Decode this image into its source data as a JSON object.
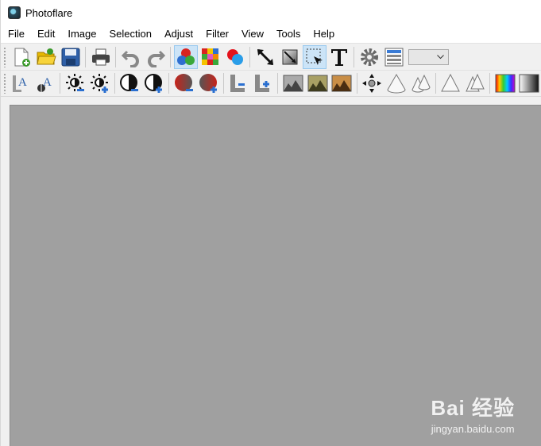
{
  "window": {
    "title": "Photoflare"
  },
  "menu": [
    "File",
    "Edit",
    "Image",
    "Selection",
    "Adjust",
    "Filter",
    "View",
    "Tools",
    "Help"
  ],
  "toolbar1": [
    "new-file-icon",
    "open-folder-icon",
    "save-icon",
    "print-icon",
    "undo-icon",
    "redo-icon",
    "color-circles-icon",
    "color-palette-icon",
    "color-picker-icon",
    "line-arrow-icon",
    "crop-icon",
    "select-arrow-icon",
    "text-tool-icon",
    "settings-gear-icon",
    "layers-icon"
  ],
  "toolbar2": [
    "font-a-icon",
    "font-a-fill-icon",
    "brightness-down-icon",
    "brightness-up-icon",
    "contrast-down-icon",
    "contrast-up-icon",
    "saturation-down-icon",
    "saturation-up-icon",
    "level-l-down-icon",
    "level-l-up-icon",
    "landscape-gray-icon",
    "landscape-olive-icon",
    "landscape-sepia-icon",
    "compass-icon",
    "cone-icon",
    "cone-double-icon",
    "triangle-icon",
    "triangle-double-icon",
    "gradient-rainbow-icon",
    "gradient-gray-icon"
  ],
  "active_tools": [
    "color-circles-icon",
    "select-arrow-icon"
  ],
  "combo": {
    "value": ""
  },
  "watermark": {
    "logo": "Bai 经验",
    "url": "jingyan.baidu.com"
  }
}
